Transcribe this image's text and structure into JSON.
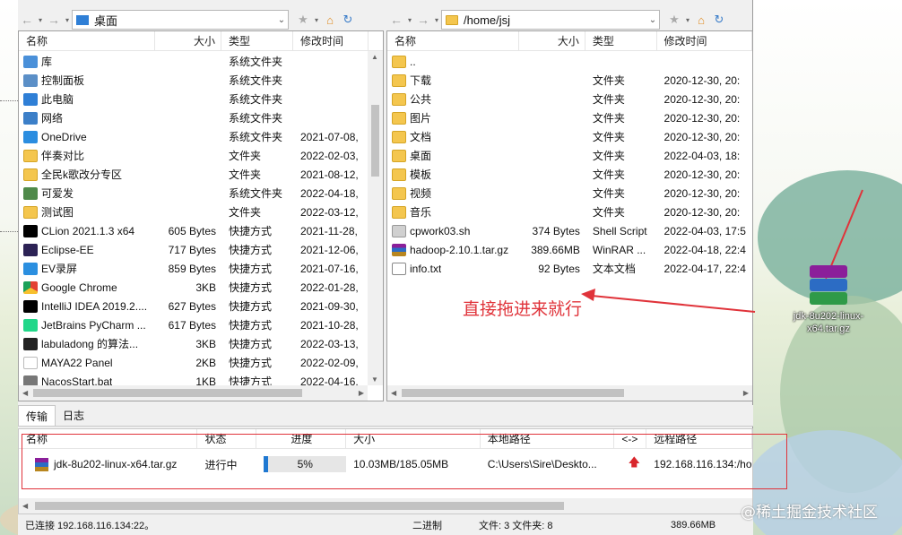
{
  "left_panel": {
    "path": "桌面",
    "columns": [
      "名称",
      "大小",
      "类型",
      "修改时间"
    ],
    "files": [
      {
        "name": "库",
        "size": "",
        "type": "系统文件夹",
        "modified": "",
        "icon": "library-icon"
      },
      {
        "name": "控制面板",
        "size": "",
        "type": "系统文件夹",
        "modified": "",
        "icon": "control-panel-icon"
      },
      {
        "name": "此电脑",
        "size": "",
        "type": "系统文件夹",
        "modified": "",
        "icon": "computer-icon"
      },
      {
        "name": "网络",
        "size": "",
        "type": "系统文件夹",
        "modified": "",
        "icon": "network-icon"
      },
      {
        "name": "OneDrive",
        "size": "",
        "type": "系统文件夹",
        "modified": "2021-07-08,",
        "icon": "cloud-icon"
      },
      {
        "name": "伴奏对比",
        "size": "",
        "type": "文件夹",
        "modified": "2022-02-03,",
        "icon": "folder-icon"
      },
      {
        "name": "全民k歌改分专区",
        "size": "",
        "type": "文件夹",
        "modified": "2021-08-12,",
        "icon": "folder-icon"
      },
      {
        "name": "可爱发",
        "size": "",
        "type": "系统文件夹",
        "modified": "2022-04-18,",
        "icon": "user-icon"
      },
      {
        "name": "测试图",
        "size": "",
        "type": "文件夹",
        "modified": "2022-03-12,",
        "icon": "folder-icon"
      },
      {
        "name": "CLion 2021.1.3 x64",
        "size": "605 Bytes",
        "type": "快捷方式",
        "modified": "2021-11-28,",
        "icon": "clion-icon"
      },
      {
        "name": "Eclipse-EE",
        "size": "717 Bytes",
        "type": "快捷方式",
        "modified": "2021-12-06,",
        "icon": "eclipse-icon"
      },
      {
        "name": "EV录屏",
        "size": "859 Bytes",
        "type": "快捷方式",
        "modified": "2021-07-16,",
        "icon": "ev-recorder-icon"
      },
      {
        "name": "Google Chrome",
        "size": "3KB",
        "type": "快捷方式",
        "modified": "2022-01-28,",
        "icon": "chrome-icon"
      },
      {
        "name": "IntelliJ IDEA 2019.2....",
        "size": "627 Bytes",
        "type": "快捷方式",
        "modified": "2021-09-30,",
        "icon": "intellij-icon"
      },
      {
        "name": "JetBrains PyCharm ...",
        "size": "617 Bytes",
        "type": "快捷方式",
        "modified": "2021-10-28,",
        "icon": "pycharm-icon"
      },
      {
        "name": "labuladong 的算法...",
        "size": "3KB",
        "type": "快捷方式",
        "modified": "2022-03-13,",
        "icon": "labuladong-icon"
      },
      {
        "name": "MAYA22 Panel",
        "size": "2KB",
        "type": "快捷方式",
        "modified": "2022-02-09,",
        "icon": "maya-icon"
      },
      {
        "name": "NacosStart.bat",
        "size": "1KB",
        "type": "快捷方式",
        "modified": "2022-04-16,",
        "icon": "bat-icon"
      }
    ]
  },
  "right_panel": {
    "path": "/home/jsj",
    "columns": [
      "名称",
      "大小",
      "类型",
      "修改时间"
    ],
    "files": [
      {
        "name": "..",
        "size": "",
        "type": "",
        "modified": "",
        "icon": "folder-icon"
      },
      {
        "name": "下载",
        "size": "",
        "type": "文件夹",
        "modified": "2020-12-30, 20:",
        "icon": "folder-icon"
      },
      {
        "name": "公共",
        "size": "",
        "type": "文件夹",
        "modified": "2020-12-30, 20:",
        "icon": "folder-icon"
      },
      {
        "name": "图片",
        "size": "",
        "type": "文件夹",
        "modified": "2020-12-30, 20:",
        "icon": "folder-icon"
      },
      {
        "name": "文档",
        "size": "",
        "type": "文件夹",
        "modified": "2020-12-30, 20:",
        "icon": "folder-icon"
      },
      {
        "name": "桌面",
        "size": "",
        "type": "文件夹",
        "modified": "2022-04-03, 18:",
        "icon": "folder-icon"
      },
      {
        "name": "模板",
        "size": "",
        "type": "文件夹",
        "modified": "2020-12-30, 20:",
        "icon": "folder-icon"
      },
      {
        "name": "视频",
        "size": "",
        "type": "文件夹",
        "modified": "2020-12-30, 20:",
        "icon": "folder-icon"
      },
      {
        "name": "音乐",
        "size": "",
        "type": "文件夹",
        "modified": "2020-12-30, 20:",
        "icon": "folder-icon"
      },
      {
        "name": "cpwork03.sh",
        "size": "374 Bytes",
        "type": "Shell Script",
        "modified": "2022-04-03, 17:5",
        "icon": "shell-script-icon"
      },
      {
        "name": "hadoop-2.10.1.tar.gz",
        "size": "389.66MB",
        "type": "WinRAR ...",
        "modified": "2022-04-18, 22:4",
        "icon": "winrar-icon"
      },
      {
        "name": "info.txt",
        "size": "92 Bytes",
        "type": "文本文档",
        "modified": "2022-04-17, 22:4",
        "icon": "text-file-icon"
      }
    ]
  },
  "transfer": {
    "tabs": [
      "传输",
      "日志"
    ],
    "columns": [
      "名称",
      "状态",
      "进度",
      "大小",
      "本地路径",
      "<->",
      "远程路径"
    ],
    "item": {
      "name": "jdk-8u202-linux-x64.tar.gz",
      "status": "进行中",
      "progress": "5%",
      "progress_value": 0.05,
      "size": "10.03MB/185.05MB",
      "local_path": "C:\\Users\\Sire\\Deskto...",
      "remote_path": "192.168.116.134:/ho"
    }
  },
  "status_bar": {
    "connection": "已连接 192.168.116.134:22。",
    "mode": "二进制",
    "counts": "文件: 3  文件夹: 8",
    "total": "389.66MB"
  },
  "annotation": "直接拖进来就行",
  "desktop_icon": {
    "label": "jdk-8u202-linux-x64.tar.gz"
  },
  "watermark": "@稀土掘金技术社区",
  "colors": {
    "annotation_red": "#e0333a",
    "progress_blue": "#1f78d1"
  }
}
